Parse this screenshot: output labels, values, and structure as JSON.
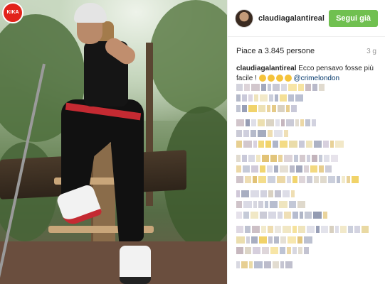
{
  "watermark": {
    "label": "KIKA"
  },
  "post": {
    "username": "claudiagalantireal",
    "follow_button": "Segui già",
    "likes_text": "Piace a 3.845 persone",
    "time_ago": "3 g",
    "caption": {
      "author": "claudiagalantireal",
      "text": "Ecco pensavo fosse più facile !",
      "emojis": [
        "thinking-face",
        "grimacing-face",
        "grinning-face",
        "sunglasses-face"
      ],
      "mention": "@crimelondon"
    }
  },
  "colors": {
    "follow_green": "#70c050",
    "mention_blue": "#003569",
    "watermark_red": "#e2231a"
  },
  "icons": [
    "user-avatar",
    "emoji"
  ]
}
